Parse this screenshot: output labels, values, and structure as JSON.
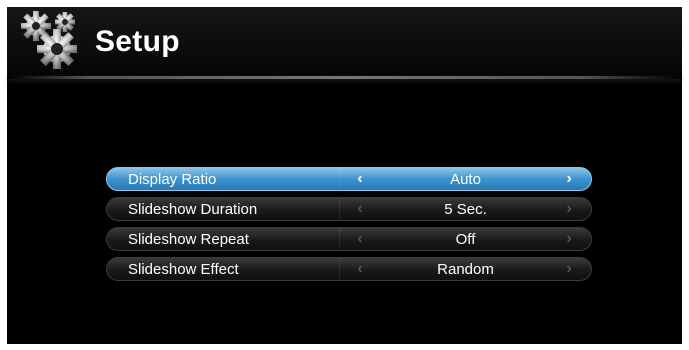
{
  "header": {
    "title": "Setup",
    "icon": "gears-icon"
  },
  "menu": {
    "items": [
      {
        "label": "Display Ratio",
        "value": "Auto",
        "selected": true
      },
      {
        "label": "Slideshow Duration",
        "value": "5 Sec.",
        "selected": false
      },
      {
        "label": "Slideshow Repeat",
        "value": "Off",
        "selected": false
      },
      {
        "label": "Slideshow Effect",
        "value": "Random",
        "selected": false
      }
    ],
    "arrow_left": "‹",
    "arrow_right": "›"
  },
  "colors": {
    "selected_row": "#3e93cc",
    "background": "#000000"
  }
}
